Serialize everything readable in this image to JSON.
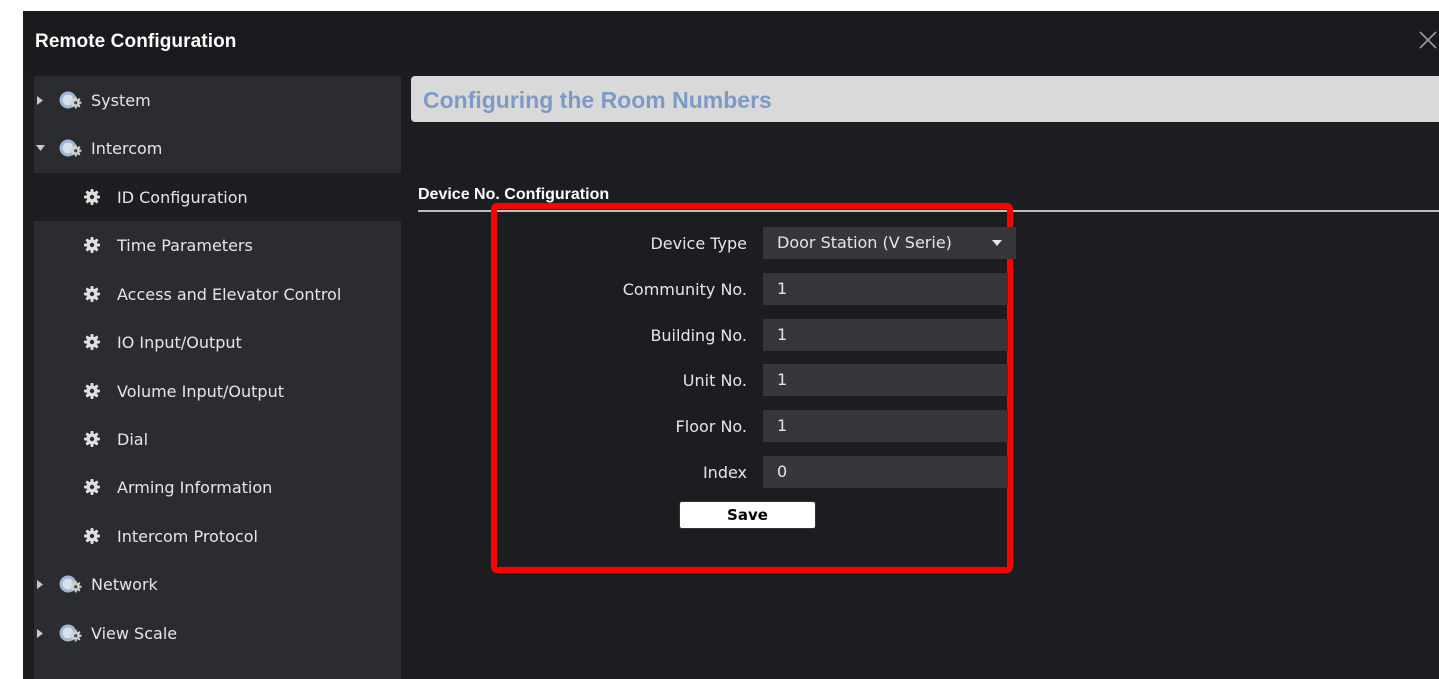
{
  "window": {
    "title": "Remote Configuration"
  },
  "sidebar": {
    "groups": [
      {
        "label": "System",
        "expanded": false
      },
      {
        "label": "Intercom",
        "expanded": true,
        "children": [
          {
            "label": "ID Configuration",
            "selected": true
          },
          {
            "label": "Time Parameters"
          },
          {
            "label": "Access and Elevator Control"
          },
          {
            "label": "IO Input/Output"
          },
          {
            "label": "Volume Input/Output"
          },
          {
            "label": "Dial"
          },
          {
            "label": "Arming Information"
          },
          {
            "label": "Intercom Protocol"
          }
        ]
      },
      {
        "label": "Network",
        "expanded": false
      },
      {
        "label": "View Scale",
        "expanded": false
      }
    ]
  },
  "main": {
    "header": "Configuring the Room Numbers",
    "section_title": "Device No. Configuration",
    "form": {
      "device_type": {
        "label": "Device Type",
        "value": "Door Station (V Serie)"
      },
      "community_no": {
        "label": "Community No.",
        "value": "1"
      },
      "building_no": {
        "label": "Building No.",
        "value": "1"
      },
      "unit_no": {
        "label": "Unit No.",
        "value": "1"
      },
      "floor_no": {
        "label": "Floor No.",
        "value": "1"
      },
      "index": {
        "label": "Index",
        "value": "0"
      },
      "save_label": "Save"
    }
  },
  "colors": {
    "highlight": "#ff0000",
    "header_text": "#7b9bc6",
    "window_bg": "#1c1d20",
    "sidebar_bg": "#2b2c30"
  },
  "icons": {
    "close": "close-icon",
    "group": "gear-cluster-icon",
    "child": "gear-icon",
    "expand_collapsed": "triangle-right-icon",
    "expand_open": "triangle-down-icon",
    "dropdown": "caret-down-icon"
  }
}
